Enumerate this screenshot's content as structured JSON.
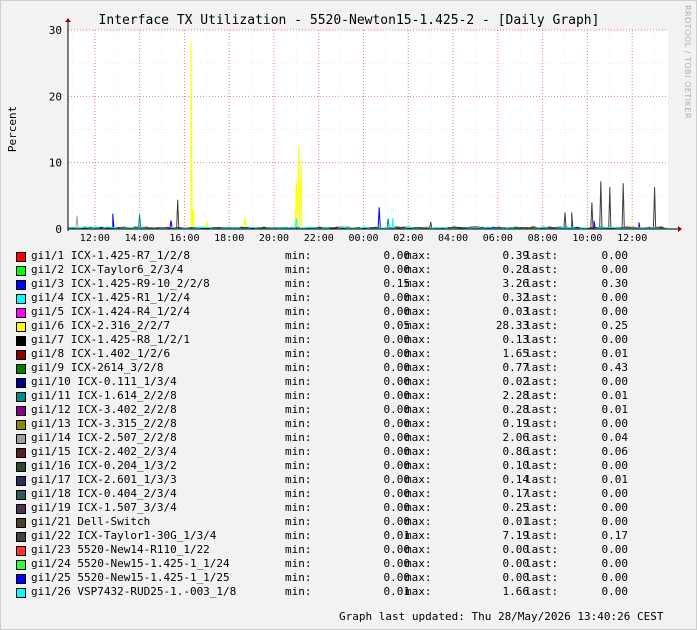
{
  "chart_data": {
    "type": "line",
    "title": "Interface TX Utilization - 5520-Newton15-1.425-2 - [Daily Graph]",
    "ylabel": "Percent",
    "xlabel": "",
    "ylim": [
      0,
      30
    ],
    "yticks": [
      "0",
      "10",
      "20",
      "30"
    ],
    "xticks": [
      "12:00",
      "14:00",
      "16:00",
      "18:00",
      "20:00",
      "22:00",
      "00:00",
      "02:00",
      "04:00",
      "06:00",
      "08:00",
      "10:00",
      "12:00"
    ],
    "xrange_hours": [
      10.8,
      37.6
    ],
    "grid": true,
    "legend_placement": "bottom",
    "series": [
      {
        "name": "gi1/1 ICX-1.425-R7_1/2/8",
        "color": "#ff0000",
        "min": "0.00",
        "max": "0.39",
        "last": "0.00",
        "spikes": []
      },
      {
        "name": "gi1/2 ICX-Taylor6_2/3/4",
        "color": "#00ff00",
        "min": "0.00",
        "max": "0.28",
        "last": "0.00",
        "spikes": []
      },
      {
        "name": "gi1/3 ICX-1.425-R9-10_2/2/8",
        "color": "#0000ff",
        "min": "0.15",
        "max": "3.26",
        "last": "0.30",
        "spikes": [
          [
            12.8,
            2.3
          ],
          [
            15.4,
            1.3
          ],
          [
            24.7,
            3.26
          ],
          [
            34.3,
            1.2
          ],
          [
            36.3,
            1.0
          ]
        ]
      },
      {
        "name": "gi1/4 ICX-1.425-R1_1/2/4",
        "color": "#00ffff",
        "min": "0.00",
        "max": "0.32",
        "last": "0.00",
        "spikes": []
      },
      {
        "name": "gi1/5 ICX-1.424-R4_1/2/4",
        "color": "#ff00ff",
        "min": "0.00",
        "max": "0.03",
        "last": "0.00",
        "spikes": []
      },
      {
        "name": "gi1/6 ICX-2.316_2/2/7",
        "color": "#ffff00",
        "min": "0.05",
        "max": "28.33",
        "last": "0.25",
        "spikes": [
          [
            16.3,
            28.33
          ],
          [
            16.4,
            3.0
          ],
          [
            17.0,
            1.2
          ],
          [
            18.7,
            1.8
          ],
          [
            21.0,
            7.0
          ],
          [
            21.1,
            12.5
          ],
          [
            21.2,
            10.0
          ]
        ]
      },
      {
        "name": "gi1/7 ICX-1.425-R8_1/2/1",
        "color": "#000000",
        "min": "0.00",
        "max": "0.13",
        "last": "0.00",
        "spikes": []
      },
      {
        "name": "gi1/8 ICX-1.402_1/2/6",
        "color": "#8b0000",
        "min": "0.00",
        "max": "1.65",
        "last": "0.01",
        "spikes": []
      },
      {
        "name": "gi1/9 ICX-2614_3/2/8",
        "color": "#008000",
        "min": "0.00",
        "max": "0.77",
        "last": "0.43",
        "spikes": []
      },
      {
        "name": "gi1/10 ICX-0.111_1/3/4",
        "color": "#00008b",
        "min": "0.00",
        "max": "0.02",
        "last": "0.00",
        "spikes": []
      },
      {
        "name": "gi1/11 ICX-1.614_2/2/8",
        "color": "#008b8b",
        "min": "0.00",
        "max": "2.28",
        "last": "0.01",
        "spikes": [
          [
            14.0,
            2.2
          ],
          [
            25.1,
            1.6
          ]
        ]
      },
      {
        "name": "gi1/12 ICX-3.402_2/2/8",
        "color": "#8b008b",
        "min": "0.00",
        "max": "0.28",
        "last": "0.01",
        "spikes": []
      },
      {
        "name": "gi1/13 ICX-3.315_2/2/8",
        "color": "#8b8b00",
        "min": "0.00",
        "max": "0.19",
        "last": "0.00",
        "spikes": []
      },
      {
        "name": "gi1/14 ICX-2.507_2/2/8",
        "color": "#a0a0a0",
        "min": "0.00",
        "max": "2.06",
        "last": "0.04",
        "spikes": [
          [
            11.2,
            2.0
          ]
        ]
      },
      {
        "name": "gi1/15 ICX-2.402_2/3/4",
        "color": "#5a2020",
        "min": "0.00",
        "max": "0.86",
        "last": "0.06",
        "spikes": []
      },
      {
        "name": "gi1/16 ICX-0.204_1/3/2",
        "color": "#2d4a2d",
        "min": "0.00",
        "max": "0.10",
        "last": "0.00",
        "spikes": []
      },
      {
        "name": "gi1/17 ICX-2.601_1/3/3",
        "color": "#283060",
        "min": "0.00",
        "max": "0.14",
        "last": "0.01",
        "spikes": []
      },
      {
        "name": "gi1/18 ICX-0.404_2/3/4",
        "color": "#305a5a",
        "min": "0.00",
        "max": "0.17",
        "last": "0.00",
        "spikes": []
      },
      {
        "name": "gi1/19 ICX-1.507_3/3/4",
        "color": "#503050",
        "min": "0.00",
        "max": "0.25",
        "last": "0.00",
        "spikes": []
      },
      {
        "name": "gi1/21 Dell-Switch",
        "color": "#504020",
        "min": "0.00",
        "max": "0.01",
        "last": "0.00",
        "spikes": []
      },
      {
        "name": "gi1/22 ICX-Taylor1-30G_1/3/4",
        "color": "#404040",
        "min": "0.01",
        "max": "7.19",
        "last": "0.17",
        "spikes": [
          [
            15.7,
            4.4
          ],
          [
            27.0,
            1.1
          ],
          [
            33.0,
            2.5
          ],
          [
            33.3,
            2.5
          ],
          [
            34.2,
            4.0
          ],
          [
            34.6,
            7.19
          ],
          [
            35.0,
            6.3
          ],
          [
            35.6,
            6.9
          ],
          [
            37.0,
            6.3
          ]
        ]
      },
      {
        "name": "gi1/23 5520-New14-R110_1/22",
        "color": "#ff3030",
        "min": "0.00",
        "max": "0.00",
        "last": "0.00",
        "spikes": []
      },
      {
        "name": "gi1/24 5520-New15-1.425-1_1/24",
        "color": "#30ff30",
        "min": "0.00",
        "max": "0.00",
        "last": "0.00",
        "spikes": []
      },
      {
        "name": "gi1/25 5520-New15-1.425-1_1/25",
        "color": "#0000ff",
        "min": "0.00",
        "max": "0.00",
        "last": "0.00",
        "spikes": []
      },
      {
        "name": "gi1/26 VSP7432-RUD25-1.-003_1/8",
        "color": "#00ffff",
        "min": "0.01",
        "max": "1.66",
        "last": "0.00",
        "spikes": [
          [
            21.0,
            1.6
          ],
          [
            25.3,
            1.66
          ]
        ]
      }
    ]
  },
  "legend": {
    "min_label": "min:",
    "max_label": "max:",
    "last_label": "last:"
  },
  "footer": {
    "updated": "Graph last updated: Thu 28/May/2026 13:40:26 CEST"
  },
  "watermark": "RRDTOOL / TOBI OETIKER"
}
